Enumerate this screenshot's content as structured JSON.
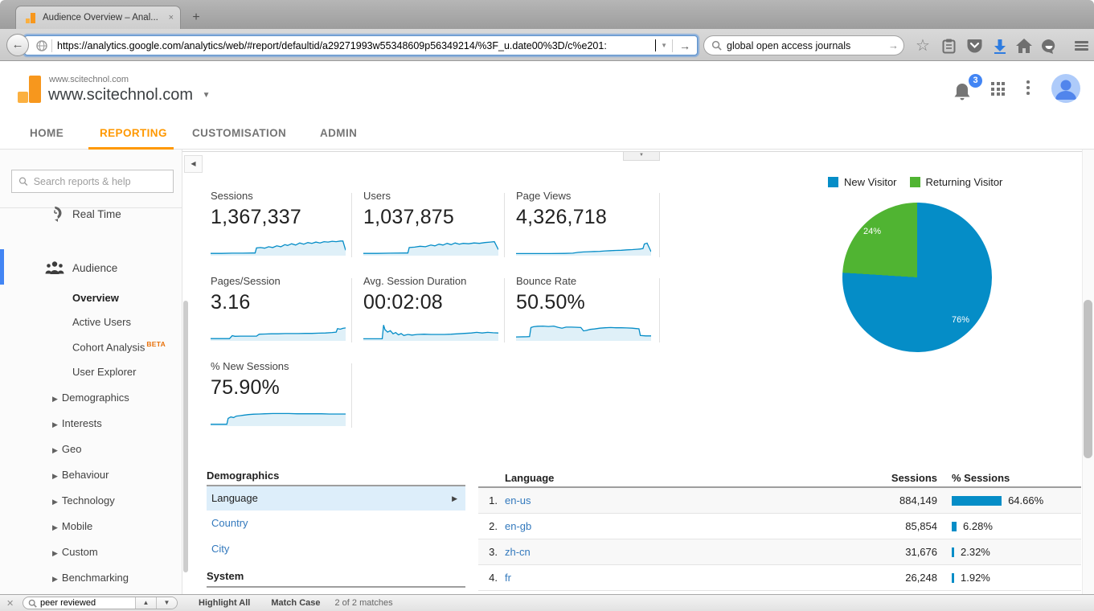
{
  "browser": {
    "tab_title": "Audience Overview – Anal...",
    "close_tab_label": "×",
    "new_tab_label": "+",
    "back_label": "←",
    "url": "https://analytics.google.com/analytics/web/#report/defaultid/a29271993w55348609p56349214/%3F_u.date00%3D/c%e201:",
    "go_label": "→",
    "search_value": "global open access journals"
  },
  "ga_header": {
    "account_small": "www.scitechnol.com",
    "account_large": "www.scitechnol.com",
    "notification_count": "3"
  },
  "nav": {
    "items": [
      {
        "label": "HOME"
      },
      {
        "label": "REPORTING"
      },
      {
        "label": "CUSTOMISATION"
      },
      {
        "label": "ADMIN"
      }
    ]
  },
  "sidebar": {
    "search_placeholder": "Search reports & help",
    "real_time_label": "Real Time",
    "audience_label": "Audience",
    "audience_items": [
      {
        "label": "Overview"
      },
      {
        "label": "Active Users"
      },
      {
        "label": "Cohort Analysis",
        "badge": "BETA"
      },
      {
        "label": "User Explorer"
      }
    ],
    "expandable_items": [
      {
        "label": "Demographics"
      },
      {
        "label": "Interests"
      },
      {
        "label": "Geo"
      },
      {
        "label": "Behaviour"
      },
      {
        "label": "Technology"
      },
      {
        "label": "Mobile"
      },
      {
        "label": "Custom"
      },
      {
        "label": "Benchmarking"
      }
    ]
  },
  "demographics_panel": {
    "title": "Demographics",
    "items": [
      {
        "label": "Language"
      },
      {
        "label": "Country"
      },
      {
        "label": "City"
      }
    ],
    "system_title": "System"
  },
  "find_bar": {
    "value": "peer reviewed",
    "highlight_all": "Highlight All",
    "match_case": "Match Case",
    "matches": "2 of 2 matches"
  },
  "colors": {
    "accent_orange": "#ff9800",
    "link_blue": "#3379bd",
    "spark_blue": "#058dc7",
    "pie_blue": "#058dc7",
    "pie_green": "#50b432",
    "badge_blue": "#4285f4"
  },
  "chart_data": [
    {
      "type": "line",
      "title": "Sessions",
      "value": "1,367,337",
      "points": [
        [
          0,
          7
        ],
        [
          8,
          7
        ],
        [
          16,
          8
        ],
        [
          24,
          8
        ],
        [
          31,
          9
        ],
        [
          33,
          9
        ],
        [
          34,
          33
        ],
        [
          37,
          35
        ],
        [
          40,
          32
        ],
        [
          43,
          39
        ],
        [
          46,
          35
        ],
        [
          49,
          43
        ],
        [
          52,
          39
        ],
        [
          55,
          49
        ],
        [
          57,
          45
        ],
        [
          60,
          53
        ],
        [
          63,
          47
        ],
        [
          66,
          57
        ],
        [
          69,
          51
        ],
        [
          72,
          59
        ],
        [
          75,
          55
        ],
        [
          78,
          61
        ],
        [
          81,
          57
        ],
        [
          84,
          63
        ],
        [
          87,
          61
        ],
        [
          90,
          65
        ],
        [
          93,
          63
        ],
        [
          96,
          66
        ],
        [
          98,
          66
        ],
        [
          100,
          22
        ]
      ]
    },
    {
      "type": "line",
      "title": "Users",
      "value": "1,037,875",
      "points": [
        [
          0,
          7
        ],
        [
          10,
          7
        ],
        [
          20,
          8
        ],
        [
          31,
          9
        ],
        [
          33,
          9
        ],
        [
          34,
          35
        ],
        [
          38,
          37
        ],
        [
          42,
          41
        ],
        [
          46,
          39
        ],
        [
          50,
          47
        ],
        [
          53,
          43
        ],
        [
          56,
          51
        ],
        [
          59,
          47
        ],
        [
          62,
          55
        ],
        [
          65,
          49
        ],
        [
          68,
          57
        ],
        [
          71,
          51
        ],
        [
          74,
          55
        ],
        [
          78,
          53
        ],
        [
          82,
          57
        ],
        [
          86,
          55
        ],
        [
          90,
          59
        ],
        [
          94,
          61
        ],
        [
          97,
          63
        ],
        [
          100,
          25
        ]
      ]
    },
    {
      "type": "line",
      "title": "Page Views",
      "value": "4,326,718",
      "points": [
        [
          0,
          6
        ],
        [
          12,
          6
        ],
        [
          24,
          6
        ],
        [
          36,
          7
        ],
        [
          42,
          8
        ],
        [
          46,
          12
        ],
        [
          50,
          14
        ],
        [
          54,
          15
        ],
        [
          58,
          16
        ],
        [
          62,
          17
        ],
        [
          66,
          19
        ],
        [
          70,
          20
        ],
        [
          74,
          21
        ],
        [
          78,
          22
        ],
        [
          82,
          24
        ],
        [
          86,
          25
        ],
        [
          90,
          27
        ],
        [
          92,
          28
        ],
        [
          94,
          30
        ],
        [
          95,
          52
        ],
        [
          97,
          56
        ],
        [
          100,
          15
        ]
      ]
    },
    {
      "type": "line",
      "title": "Pages/Session",
      "value": "3.16",
      "points": [
        [
          0,
          7
        ],
        [
          14,
          7
        ],
        [
          16,
          21
        ],
        [
          18,
          18
        ],
        [
          22,
          19
        ],
        [
          26,
          19
        ],
        [
          30,
          19
        ],
        [
          34,
          19
        ],
        [
          36,
          28
        ],
        [
          40,
          29
        ],
        [
          45,
          30
        ],
        [
          50,
          30
        ],
        [
          55,
          31
        ],
        [
          60,
          31
        ],
        [
          65,
          31
        ],
        [
          70,
          32
        ],
        [
          75,
          32
        ],
        [
          80,
          33
        ],
        [
          85,
          34
        ],
        [
          90,
          36
        ],
        [
          93,
          38
        ],
        [
          94,
          55
        ],
        [
          96,
          52
        ],
        [
          98,
          56
        ],
        [
          100,
          58
        ]
      ]
    },
    {
      "type": "line",
      "title": "Avg. Session Duration",
      "value": "00:02:08",
      "points": [
        [
          0,
          6
        ],
        [
          12,
          6
        ],
        [
          14,
          6
        ],
        [
          15,
          72
        ],
        [
          16,
          50
        ],
        [
          18,
          38
        ],
        [
          20,
          45
        ],
        [
          22,
          30
        ],
        [
          24,
          36
        ],
        [
          26,
          25
        ],
        [
          28,
          31
        ],
        [
          30,
          22
        ],
        [
          33,
          27
        ],
        [
          36,
          24
        ],
        [
          40,
          27
        ],
        [
          45,
          28
        ],
        [
          50,
          27
        ],
        [
          55,
          27
        ],
        [
          60,
          27
        ],
        [
          65,
          28
        ],
        [
          70,
          30
        ],
        [
          75,
          32
        ],
        [
          80,
          34
        ],
        [
          84,
          37
        ],
        [
          88,
          34
        ],
        [
          92,
          37
        ],
        [
          96,
          35
        ],
        [
          100,
          34
        ]
      ]
    },
    {
      "type": "line",
      "title": "Bounce Rate",
      "value": "50.50%",
      "points": [
        [
          0,
          15
        ],
        [
          8,
          16
        ],
        [
          10,
          17
        ],
        [
          11,
          60
        ],
        [
          13,
          64
        ],
        [
          16,
          66
        ],
        [
          20,
          67
        ],
        [
          24,
          65
        ],
        [
          28,
          67
        ],
        [
          31,
          61
        ],
        [
          34,
          57
        ],
        [
          37,
          62
        ],
        [
          41,
          62
        ],
        [
          45,
          61
        ],
        [
          48,
          60
        ],
        [
          50,
          44
        ],
        [
          52,
          46
        ],
        [
          55,
          51
        ],
        [
          58,
          53
        ],
        [
          62,
          57
        ],
        [
          66,
          59
        ],
        [
          70,
          60
        ],
        [
          74,
          59
        ],
        [
          78,
          59
        ],
        [
          82,
          58
        ],
        [
          86,
          57
        ],
        [
          89,
          55
        ],
        [
          91,
          54
        ],
        [
          92,
          22
        ],
        [
          96,
          20
        ],
        [
          100,
          20
        ]
      ]
    },
    {
      "type": "line",
      "title": "% New Sessions",
      "value": "75.90%",
      "points": [
        [
          0,
          5
        ],
        [
          10,
          5
        ],
        [
          12,
          5
        ],
        [
          13,
          33
        ],
        [
          15,
          40
        ],
        [
          17,
          37
        ],
        [
          19,
          44
        ],
        [
          22,
          46
        ],
        [
          25,
          49
        ],
        [
          28,
          51
        ],
        [
          32,
          53
        ],
        [
          36,
          54
        ],
        [
          40,
          55
        ],
        [
          46,
          56
        ],
        [
          52,
          56
        ],
        [
          58,
          56
        ],
        [
          64,
          55
        ],
        [
          70,
          55
        ],
        [
          76,
          55
        ],
        [
          82,
          55
        ],
        [
          88,
          54
        ],
        [
          94,
          54
        ],
        [
          100,
          54
        ]
      ]
    },
    {
      "type": "pie",
      "title": "New vs Returning Visitors",
      "legend": [
        "New Visitor",
        "Returning Visitor"
      ],
      "values": [
        76,
        24
      ],
      "labels": [
        "76%",
        "24%"
      ],
      "colors": [
        "#058dc7",
        "#50b432"
      ]
    },
    {
      "type": "table",
      "title": "Language",
      "columns": [
        "Language",
        "Sessions",
        "% Sessions"
      ],
      "rows": [
        {
          "rank": "1.",
          "language": "en-us",
          "sessions": "884,149",
          "pct": 64.66,
          "pct_label": "64.66%"
        },
        {
          "rank": "2.",
          "language": "en-gb",
          "sessions": "85,854",
          "pct": 6.28,
          "pct_label": "6.28%"
        },
        {
          "rank": "3.",
          "language": "zh-cn",
          "sessions": "31,676",
          "pct": 2.32,
          "pct_label": "2.32%"
        },
        {
          "rank": "4.",
          "language": "fr",
          "sessions": "26,248",
          "pct": 1.92,
          "pct_label": "1.92%"
        }
      ]
    }
  ]
}
